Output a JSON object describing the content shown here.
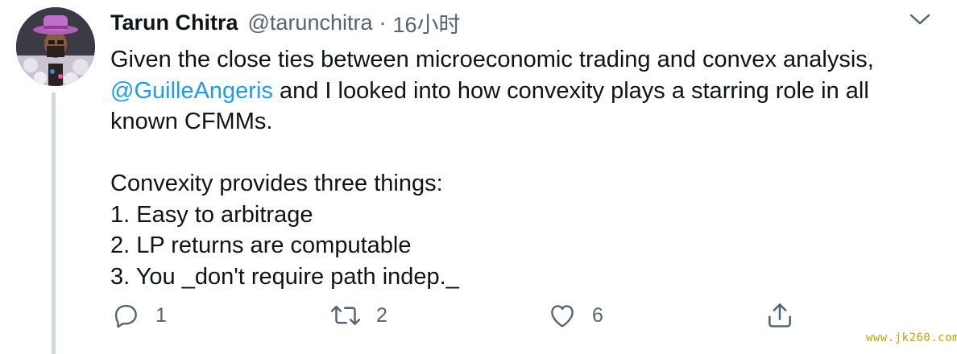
{
  "author": {
    "name": "Tarun Chitra",
    "handle": "@tarunchitra",
    "separator": "·",
    "time": "16小时"
  },
  "tweet": {
    "line1": "Given the close ties between microeconomic trading and convex analysis,",
    "mention": "@GuilleAngeris",
    "line2_rest": " and I looked into how convexity plays a starring role in all",
    "line3": "known CFMMs.",
    "line4": "Convexity provides three things:",
    "line5": "1. Easy to arbitrage",
    "line6": "2. LP returns are computable",
    "line7": "3. You _don't require path indep._"
  },
  "actions": {
    "reply_count": "1",
    "retweet_count": "2",
    "like_count": "6"
  },
  "icons": {
    "reply": "speech-bubble-icon",
    "retweet": "retweet-arrows-icon",
    "like": "heart-icon",
    "share": "share-upload-icon",
    "menu": "chevron-down-icon"
  },
  "colors": {
    "mention": "#1d9bf0",
    "secondary_text": "#536471",
    "thread_line": "#cfd9de"
  },
  "watermark": "www.jk260.com"
}
